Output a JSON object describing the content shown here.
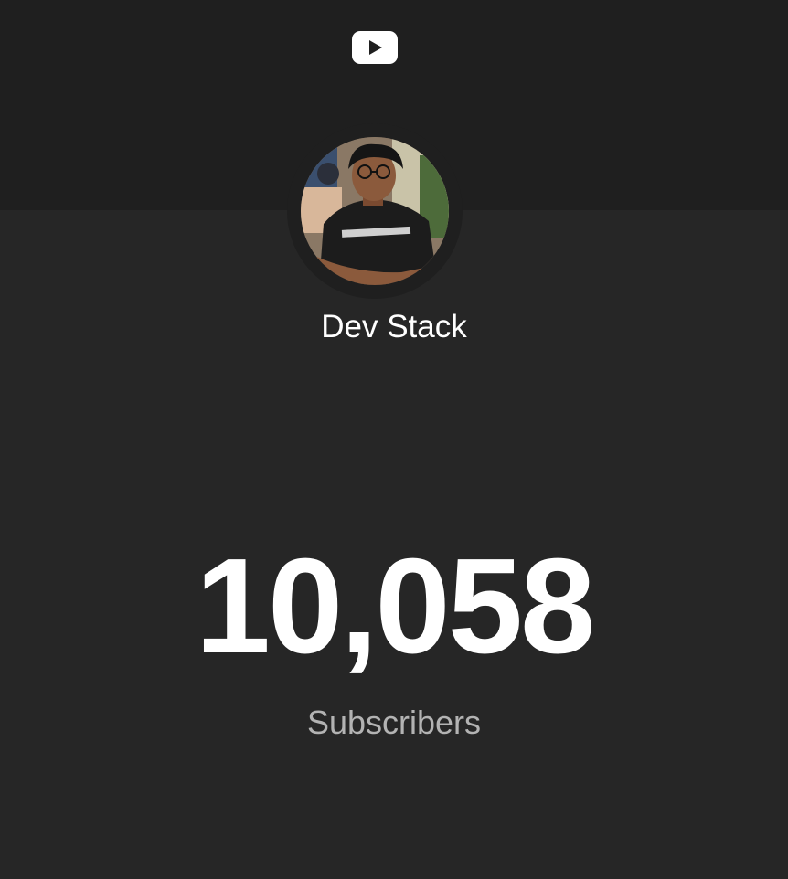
{
  "logo": {
    "icon": "youtube-icon",
    "color": "#ffffff"
  },
  "channel": {
    "name": "Dev Stack",
    "avatar": "channel-avatar-photo"
  },
  "stats": {
    "subscriber_count": "10,058",
    "subscriber_label": "Subscribers"
  },
  "colors": {
    "header_bg": "#1f1f1f",
    "page_bg": "#262626",
    "label_text": "#b3b3b3"
  }
}
